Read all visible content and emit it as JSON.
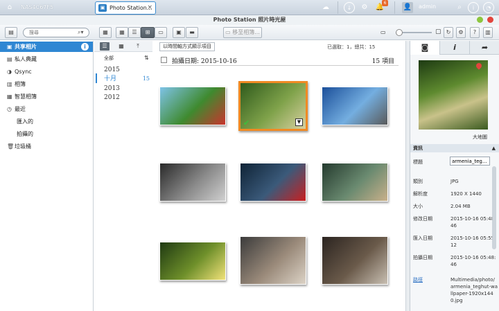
{
  "system_bar": {
    "host": "NAS4C67F5",
    "app_tab": "Photo Station...",
    "notification_count": "6",
    "user": "admin",
    "icons": [
      "home-icon",
      "cloud-icon",
      "download-icon",
      "settings-icon",
      "notification-icon",
      "user-icon",
      "search-icon",
      "info-icon",
      "dashboard-icon"
    ]
  },
  "window": {
    "title": "Photo Station 照片時光屋",
    "controls_colors": [
      "#8dc63f",
      "#e2453d"
    ]
  },
  "toolbar": {
    "search_placeholder": "搜尋",
    "icons": [
      "sidebar-toggle-icon",
      "slideshow-icon",
      "thumbnail-view-icon",
      "list-view-icon",
      "timeline-view-icon",
      "folder-view-icon",
      "photo-filter-icon",
      "video-filter-icon",
      "add-to-album-icon",
      "refresh-icon",
      "settings-icon",
      "help-icon",
      "info-panel-icon"
    ],
    "add_album": "移至相簿..."
  },
  "sidebar": {
    "items": [
      {
        "label": "共享相片",
        "icon": "shared-photos-icon",
        "selected": true
      },
      {
        "label": "私人典藏",
        "icon": "private-collection-icon"
      },
      {
        "label": "Qsync",
        "icon": "qsync-icon"
      },
      {
        "label": "相簿",
        "icon": "album-icon"
      },
      {
        "label": "智慧相簿",
        "icon": "smart-album-icon"
      },
      {
        "label": "最近",
        "icon": "recent-icon"
      },
      {
        "label": "匯入的",
        "sub": true
      },
      {
        "label": "拍攝的",
        "sub": true
      },
      {
        "label": "垃圾桶",
        "icon": "trash-icon"
      }
    ]
  },
  "timeline": {
    "all_label": "全部",
    "rows": [
      {
        "label": "2015",
        "count": ""
      },
      {
        "label": "十月",
        "count": "15",
        "selected": true
      },
      {
        "label": "2013",
        "count": ""
      },
      {
        "label": "2012",
        "count": ""
      }
    ]
  },
  "main": {
    "view_mode_label": "以時間軸方式顯示項目",
    "selection_info": "已選取：1，總共：15",
    "group_title": "拍攝日期: 2015-10-16",
    "group_count": "15 項目",
    "thumbnails": [
      {
        "name": "angry-birds",
        "colors": [
          "#7ec3e8",
          "#3f8a2f",
          "#c9342e"
        ],
        "selected": false
      },
      {
        "name": "armenia-forest-path",
        "colors": [
          "#2f5a1c",
          "#7fa24a",
          "#d8d0a0"
        ],
        "selected": true
      },
      {
        "name": "desert-road",
        "colors": [
          "#1b4f9a",
          "#74aee0",
          "#5a5a5a"
        ],
        "selected": false
      },
      {
        "name": "dark-robot",
        "colors": [
          "#2a2a2a",
          "#8a8a8a",
          "#d0d0d0"
        ],
        "selected": false
      },
      {
        "name": "sith-lightsaber",
        "colors": [
          "#0f2336",
          "#3b5a7a",
          "#c91f1f"
        ],
        "selected": false
      },
      {
        "name": "canal-night",
        "colors": [
          "#243a2e",
          "#6a8a70",
          "#c9b08a"
        ],
        "selected": false
      },
      {
        "name": "sunlit-forest",
        "colors": [
          "#1f3a12",
          "#6e8f2a",
          "#f1e27a"
        ],
        "selected": false
      },
      {
        "name": "model-portrait",
        "colors": [
          "#3b3b3b",
          "#9a8a7a",
          "#dcd3c6"
        ],
        "selected": false
      },
      {
        "name": "witcher-warrior",
        "colors": [
          "#2b2420",
          "#6a5a4a",
          "#c8bfb2"
        ],
        "selected": false
      }
    ]
  },
  "right_panel": {
    "tabs": [
      "camera-icon",
      "info-icon",
      "share-icon"
    ],
    "map_label": "大地圖",
    "info_header": "資訊",
    "rows": [
      {
        "key": "標題",
        "value": "armenia_teg...",
        "input": true
      },
      {
        "key": "類別",
        "value": "JPG"
      },
      {
        "key": "解析度",
        "value": "1920 X 1440"
      },
      {
        "key": "大小",
        "value": "2.04 MB"
      },
      {
        "key": "修改日期",
        "value": "2015-10-16 05:48:46"
      },
      {
        "key": "匯入日期",
        "value": "2015-10-16 05:55:12"
      },
      {
        "key": "拍攝日期",
        "value": "2015-10-16 05:48:46"
      },
      {
        "key": "路徑",
        "value": "Multimedia/photo/armenia_teghut-wallpaper-1920x1440.jpg",
        "link": true
      }
    ]
  }
}
